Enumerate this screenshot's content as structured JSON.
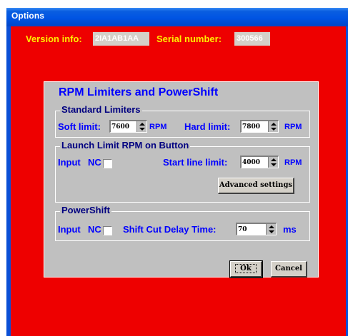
{
  "window": {
    "title": "Options"
  },
  "info": {
    "version_label": "Version info:",
    "version_value": "2IA1AB1AA",
    "serial_label": "Serial number:",
    "serial_value": "300566"
  },
  "panel": {
    "title": "RPM Limiters and PowerShift",
    "standard": {
      "title": "Standard Limiters",
      "soft_label": "Soft limit:",
      "soft_value": "7600",
      "soft_unit": "RPM",
      "hard_label": "Hard limit:",
      "hard_value": "7800",
      "hard_unit": "RPM"
    },
    "launch": {
      "title": "Launch Limit RPM on Button",
      "input_label": "Input",
      "nc_label": "NC",
      "start_label": "Start line limit:",
      "start_value": "4000",
      "start_unit": "RPM",
      "advanced_label": "Advanced settings"
    },
    "powershift": {
      "title": "PowerShift",
      "input_label": "Input",
      "nc_label": "NC",
      "delay_label": "Shift Cut Delay Time:",
      "delay_value": "70",
      "delay_unit": "ms"
    },
    "ok_label": "Ok",
    "cancel_label": "Cancel"
  },
  "colors": {
    "background": "#ee0000",
    "titlebar": "#0054e3",
    "info_text": "#ffee00",
    "label_text": "#0000ff",
    "panel": "#c0c0c0"
  }
}
